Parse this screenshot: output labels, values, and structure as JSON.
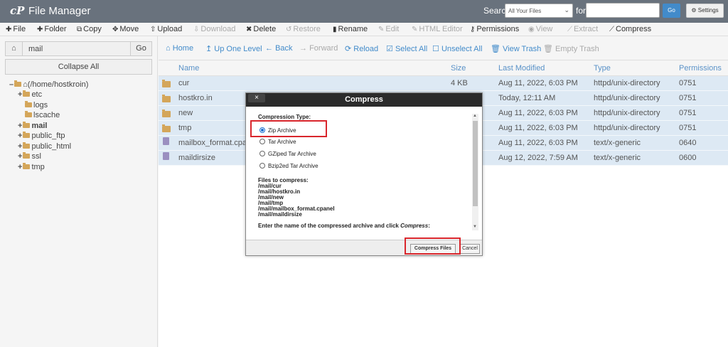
{
  "header": {
    "logo": "cP",
    "title": "File Manager",
    "search_label": "Search",
    "search_scope": "All Your Files",
    "for_label": "for",
    "search_query": "",
    "go_label": "Go",
    "settings_label": "Settings"
  },
  "toolbar": {
    "file": "File",
    "folder": "Folder",
    "copy": "Copy",
    "move": "Move",
    "upload": "Upload",
    "download": "Download",
    "delete": "Delete",
    "restore": "Restore",
    "rename": "Rename",
    "edit": "Edit",
    "html_editor": "HTML Editor",
    "permissions": "Permissions",
    "view": "View",
    "extract": "Extract",
    "compress": "Compress"
  },
  "sidebar": {
    "path_value": "mail",
    "go_label": "Go",
    "collapse_label": "Collapse All",
    "root_label": "(/home/hostkroin)",
    "tree": [
      "etc",
      "logs",
      "lscache",
      "mail",
      "public_ftp",
      "public_html",
      "ssl",
      "tmp"
    ]
  },
  "nav": {
    "home": "Home",
    "up_one_level": "Up One Level",
    "back": "Back",
    "forward": "Forward",
    "reload": "Reload",
    "select_all": "Select All",
    "unselect_all": "Unselect All",
    "view_trash": "View Trash",
    "empty_trash": "Empty Trash"
  },
  "table": {
    "headers": {
      "name": "Name",
      "size": "Size",
      "modified": "Last Modified",
      "type": "Type",
      "perms": "Permissions"
    },
    "rows": [
      {
        "name": "cur",
        "size": "4 KB",
        "modified": "Aug 11, 2022, 6:03 PM",
        "type": "httpd/unix-directory",
        "perms": "0751"
      },
      {
        "name": "hostkro.in",
        "size": "",
        "modified": "Today, 12:11 AM",
        "type": "httpd/unix-directory",
        "perms": "0751"
      },
      {
        "name": "new",
        "size": "",
        "modified": "Aug 11, 2022, 6:03 PM",
        "type": "httpd/unix-directory",
        "perms": "0751"
      },
      {
        "name": "tmp",
        "size": "",
        "modified": "Aug 11, 2022, 6:03 PM",
        "type": "httpd/unix-directory",
        "perms": "0751"
      },
      {
        "name": "mailbox_format.cpanel",
        "size": "",
        "modified": "Aug 11, 2022, 6:03 PM",
        "type": "text/x-generic",
        "perms": "0640"
      },
      {
        "name": "maildirsize",
        "size": "",
        "modified": "Aug 12, 2022, 7:59 AM",
        "type": "text/x-generic",
        "perms": "0600"
      }
    ]
  },
  "modal": {
    "close_label": "×",
    "title": "Compress",
    "compression_type_label": "Compression Type:",
    "options": [
      "Zip Archive",
      "Tar Archive",
      "GZiped Tar Archive",
      "Bzip2ed Tar Archive"
    ],
    "selected_option": "Zip Archive",
    "files_label": "Files to compress:",
    "files": [
      "/mail/cur",
      "/mail/hostkro.in",
      "/mail/new",
      "/mail/tmp",
      "/mail/mailbox_format.cpanel",
      "/mail/maildirsize"
    ],
    "instruction_prefix": "Enter the name of the compressed archive and click ",
    "instruction_em": "Compress",
    "instruction_suffix": ":",
    "compress_button": "Compress Files",
    "cancel_button": "Cancel"
  },
  "colors": {
    "header_bg": "#69727d",
    "link": "#428bca",
    "row_selected": "#dde9f4",
    "annotation": "#d9262c"
  }
}
